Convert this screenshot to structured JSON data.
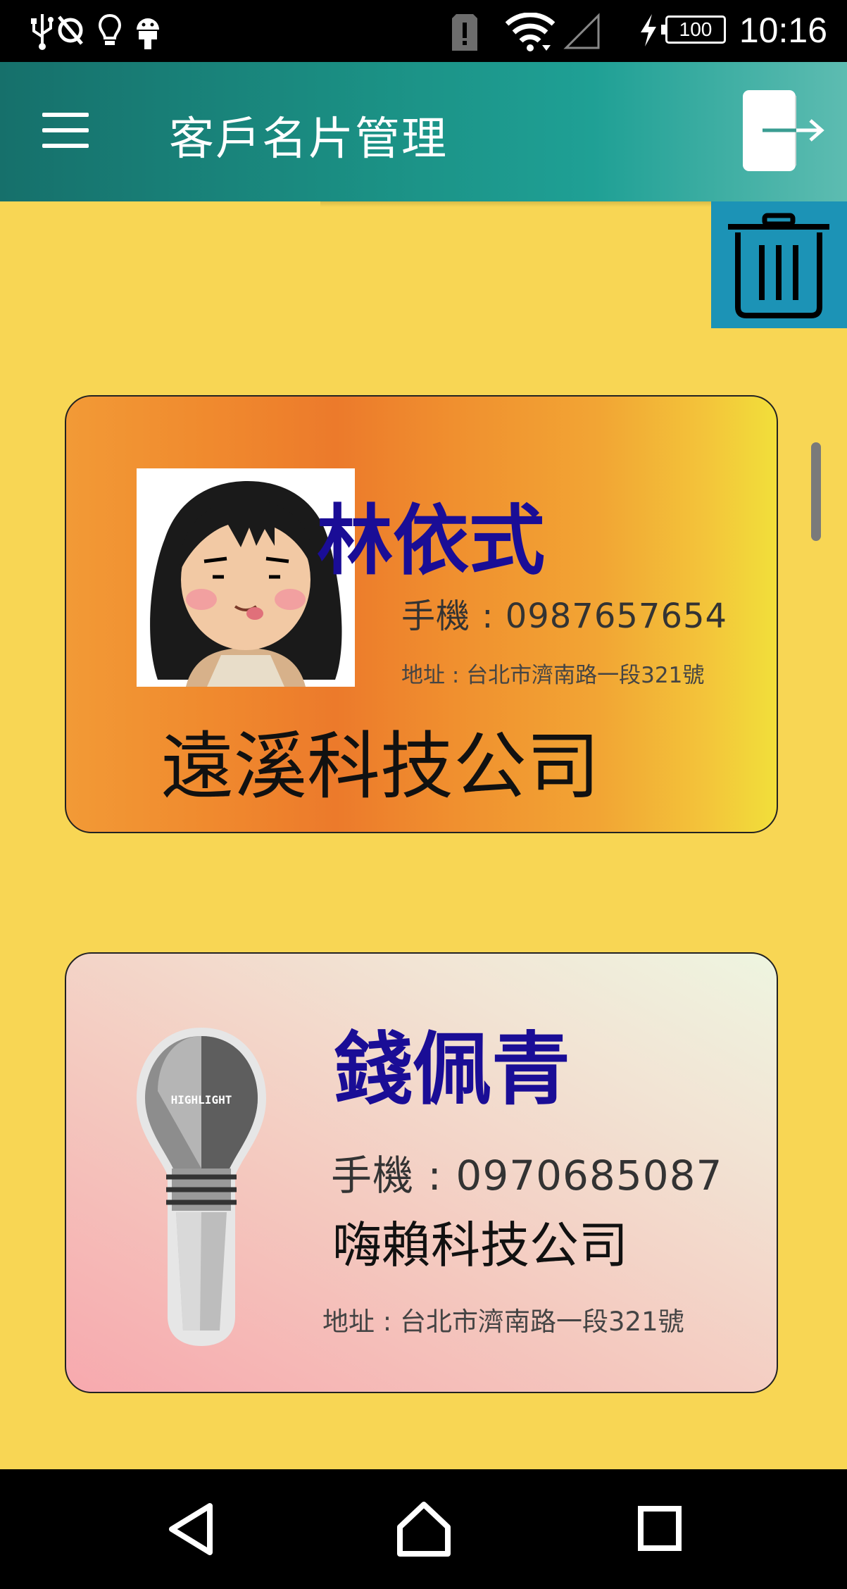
{
  "status_bar": {
    "time": "10:16",
    "battery": "100",
    "icons": [
      "usb-icon",
      "sync-off-icon",
      "bulb-icon",
      "android-icon",
      "alert-icon",
      "wifi-icon",
      "signal-icon",
      "charging-icon"
    ]
  },
  "app_bar": {
    "title": "客戶名片管理",
    "menu_icon": "menu-icon",
    "logout_icon": "logout-icon"
  },
  "actions": {
    "delete_icon": "trash-icon"
  },
  "cards": [
    {
      "name": "林依式",
      "phone": "手機 : 0987657654",
      "address": "地址 : 台北市濟南路一段321號",
      "company": "遠溪科技公司",
      "avatar": "girl-avatar"
    },
    {
      "name": "錢佩青",
      "phone": "手機 : 0970685087",
      "address": "地址 : 台北市濟南路一段321號",
      "company": "嗨賴科技公司",
      "avatar": "lightbulb-avatar",
      "avatar_text": "HIGHLIGHT"
    }
  ],
  "nav_bar": {
    "items": [
      "back-icon",
      "home-icon",
      "recents-icon"
    ]
  },
  "colors": {
    "background": "#f8d654",
    "app_bar": "#1b9185",
    "delete_button": "#1c93b6",
    "name_text": "#1a0d96"
  }
}
